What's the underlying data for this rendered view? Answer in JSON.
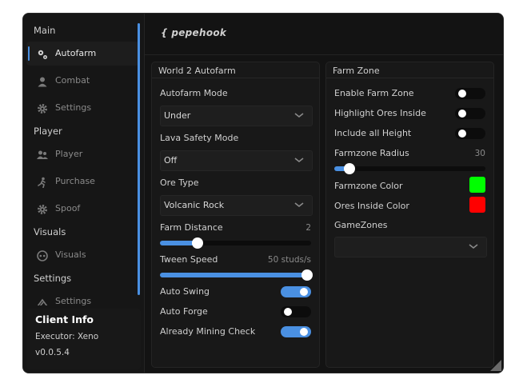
{
  "sidebar": {
    "sections": [
      "Main",
      "Player",
      "Visuals",
      "Settings"
    ],
    "items": [
      {
        "label": "Autofarm",
        "icon": "gears-icon",
        "active": true
      },
      {
        "label": "Combat",
        "icon": "person-icon",
        "active": false
      },
      {
        "label": "Settings",
        "icon": "gear-icon",
        "active": false
      },
      {
        "label": "Player",
        "icon": "people-icon",
        "active": false
      },
      {
        "label": "Purchase",
        "icon": "running-icon",
        "active": false
      },
      {
        "label": "Spoof",
        "icon": "gear-icon",
        "active": false
      },
      {
        "label": "Visuals",
        "icon": "eye-face-icon",
        "active": false
      },
      {
        "label": "Settings",
        "icon": "run-arrow-icon",
        "active": false
      }
    ]
  },
  "client_info": {
    "title": "Client Info",
    "executor": "Executor: Xeno",
    "version": "v0.0.5.4"
  },
  "header": {
    "logo_text": "{ pepehook"
  },
  "left_panel": {
    "title": "World 2 Autofarm",
    "autofarm_mode_label": "Autofarm Mode",
    "autofarm_mode_value": "Under",
    "lava_mode_label": "Lava Safety Mode",
    "lava_mode_value": "Off",
    "ore_type_label": "Ore Type",
    "ore_type_value": "Volcanic Rock",
    "farm_distance_label": "Farm Distance",
    "farm_distance_value": "2",
    "farm_distance_fraction": 0.25,
    "tween_speed_label": "Tween Speed",
    "tween_speed_value": "50 studs/s",
    "tween_speed_fraction": 1.0,
    "auto_swing_label": "Auto Swing",
    "auto_swing_on": true,
    "auto_forge_label": "Auto Forge",
    "auto_forge_on": false,
    "mining_check_label": "Already Mining Check",
    "mining_check_on": true
  },
  "right_panel": {
    "title": "Farm Zone",
    "enable_label": "Enable Farm Zone",
    "enable_on": false,
    "highlight_label": "Highlight Ores Inside",
    "highlight_on": false,
    "include_height_label": "Include all Height",
    "include_height_on": false,
    "radius_label": "Farmzone Radius",
    "radius_value": "30",
    "radius_fraction": 0.1,
    "farmzone_color_label": "Farmzone Color",
    "farmzone_color": "#00ff00",
    "ores_color_label": "Ores Inside Color",
    "ores_color": "#ff0000",
    "gamezones_label": "GameZones",
    "gamezones_value": ""
  },
  "colors": {
    "accent": "#4a90e2",
    "background": "#131313",
    "panel": "#181818"
  }
}
